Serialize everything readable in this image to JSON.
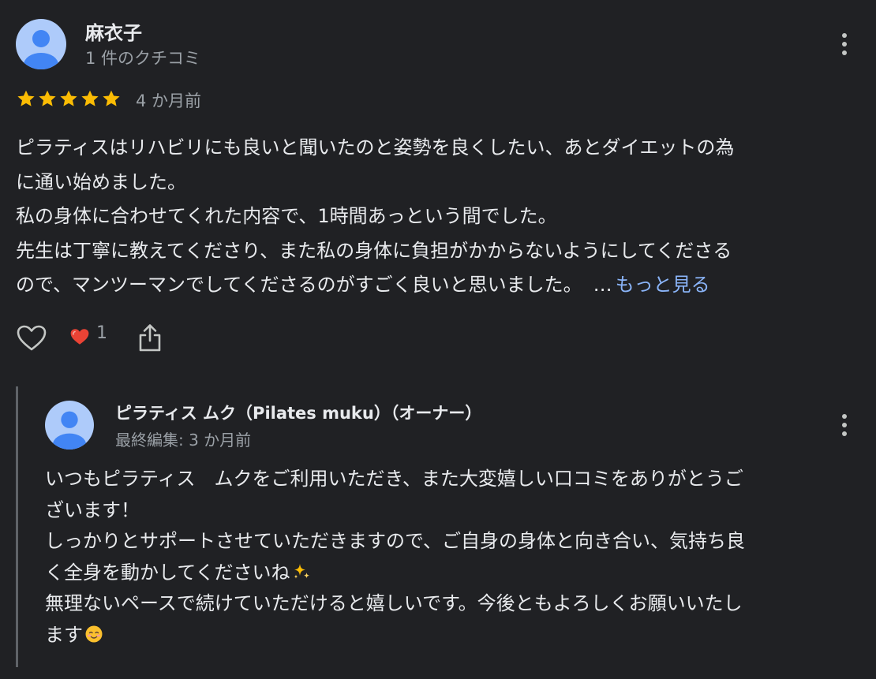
{
  "review": {
    "reviewer_name": "麻衣子",
    "reviewer_meta": "1 件のクチコミ",
    "rating": 5,
    "date": "4 か月前",
    "text_lines": [
      "ピラティスはリハビリにも良いと聞いたのと姿勢を良くしたい、あとダイエットの為",
      "に通い始めました。",
      "私の身体に合わせてくれた内容で、1時間あっという間でした。",
      "先生は丁寧に教えてくださり、また私の身体に負担がかからないようにしてくださる",
      "ので、マンツーマンでしてくださるのがすごく良いと思いました。"
    ],
    "ellipsis": "…",
    "more_label": "もっと見る",
    "reaction_count": "1"
  },
  "reply": {
    "owner_name": "ピラティス ムク（Pilates muku）（オーナー）",
    "owner_meta": "最終編集: 3 か月前",
    "text_lines": [
      "いつもピラティス　ムクをご利用いただき、また大変嬉しい口コミをありがとうご",
      "ざいます！",
      "しっかりとサポートさせていただきますので、ご自身の身体と向き合い、気持ち良",
      "く全身を動かしてくださいね",
      "無理ないペースで続けていただけると嬉しいです。今後ともよろしくお願いいたし",
      "ます"
    ]
  },
  "icons": {
    "star": "star-icon",
    "more": "more-vert-icon",
    "like": "heart-outline-icon",
    "reaction": "red-heart-icon",
    "share": "share-icon",
    "sparkles": "sparkles-emoji",
    "smile": "smiling-face-emoji"
  },
  "colors": {
    "background": "#202124",
    "star": "#fbbc04",
    "link": "#8ab4f8",
    "heart": "#ea4335",
    "avatar": "#aecbfa",
    "avatar_figure": "#4285f4"
  }
}
